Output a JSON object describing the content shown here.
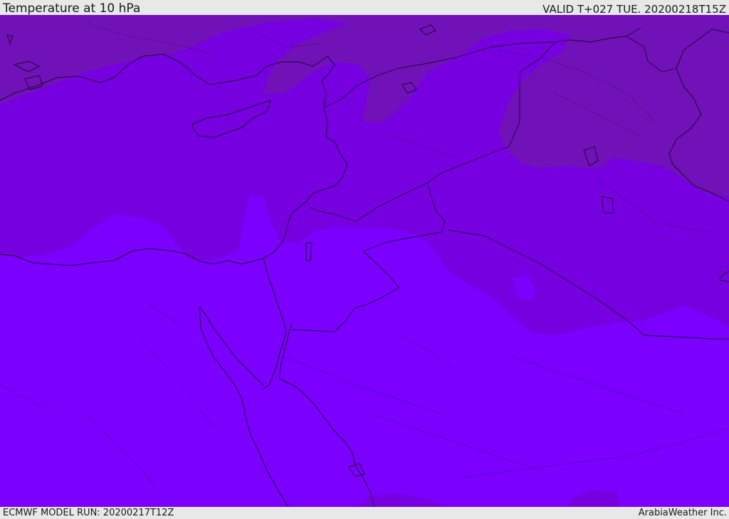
{
  "header": {
    "title": "Temperature at 10 hPa",
    "valid": "VALID T+027 TUE. 20200218T15Z"
  },
  "footer": {
    "model_run": "ECMWF MODEL RUN: 20200217T12Z",
    "credit": "ArabiaWeather Inc."
  },
  "colors": {
    "warm_band": "#7b00ff",
    "mid_band": "#7600e0",
    "cold_band": "#7112b8"
  }
}
